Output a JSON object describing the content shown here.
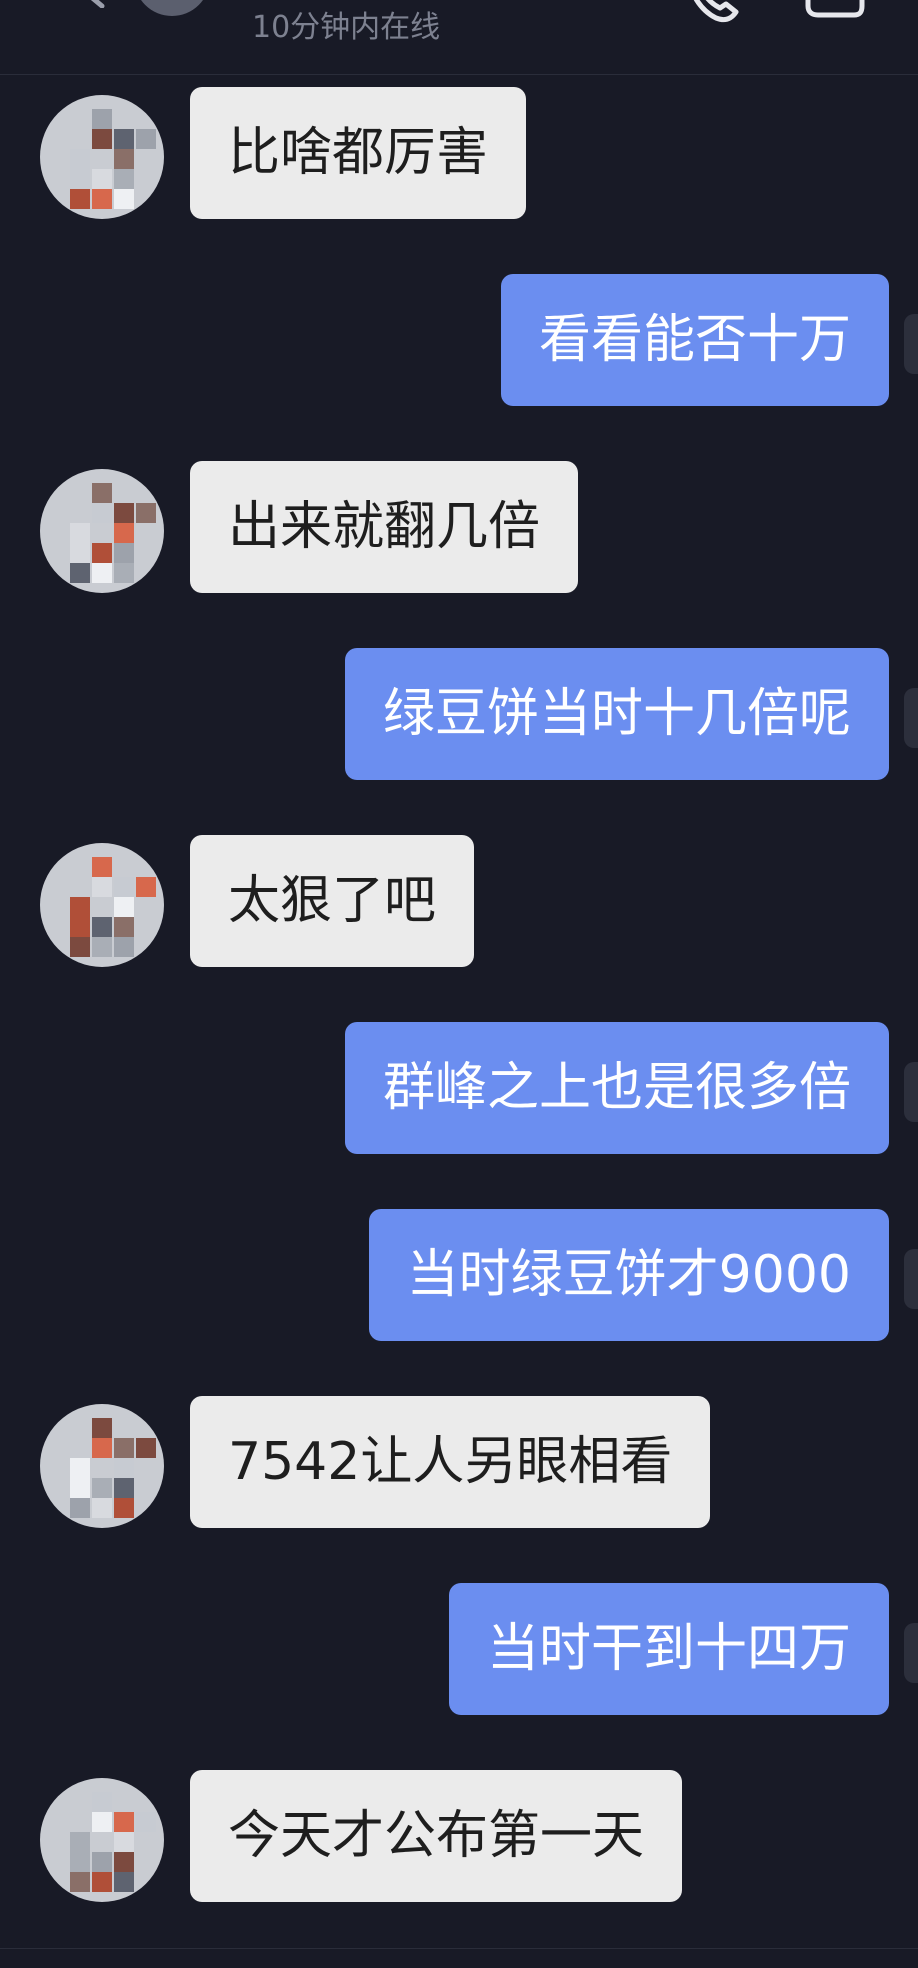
{
  "header": {
    "status": "10分钟内在线",
    "back_icon": "chevron-left-icon",
    "call_icon": "phone-icon",
    "video_icon": "video-camera-icon"
  },
  "colors": {
    "background": "#181a26",
    "incoming_bubble": "#ebebeb",
    "outgoing_bubble": "#6b8ef0"
  },
  "messages": [
    {
      "side": "incoming",
      "text": "比啥都厉害"
    },
    {
      "side": "outgoing",
      "text": "看看能否十万"
    },
    {
      "side": "incoming",
      "text": "出来就翻几倍"
    },
    {
      "side": "outgoing",
      "text": "绿豆饼当时十几倍呢"
    },
    {
      "side": "incoming",
      "text": "太狠了吧"
    },
    {
      "side": "outgoing",
      "text": "群峰之上也是很多倍"
    },
    {
      "side": "outgoing",
      "text": "当时绿豆饼才9000"
    },
    {
      "side": "incoming",
      "text": "7542让人另眼相看"
    },
    {
      "side": "outgoing",
      "text": "当时干到十四万"
    },
    {
      "side": "incoming",
      "text": "今天才公布第一天"
    }
  ]
}
